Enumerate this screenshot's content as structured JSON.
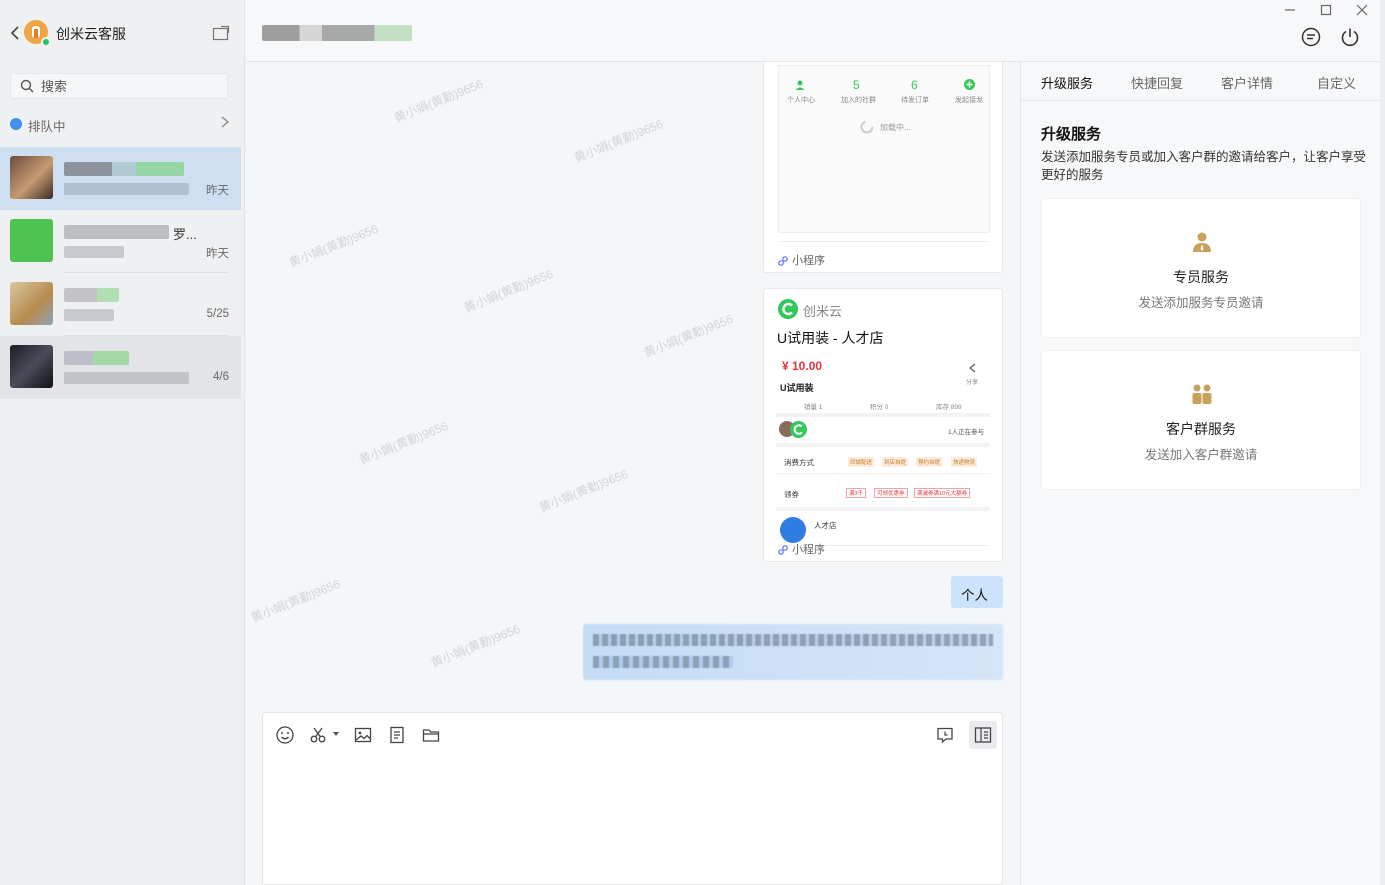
{
  "sidebar": {
    "app_name": "创米云客服",
    "search_placeholder": "搜索",
    "queue_label": "排队中",
    "conversations": [
      {
        "time": "昨天",
        "avatar_color": "#8a6a58"
      },
      {
        "name_suffix": "罗...",
        "time": "昨天",
        "avatar_color": "#4fc34f"
      },
      {
        "time": "5/25",
        "avatar_color": "#c9a86a"
      },
      {
        "time": "4/6",
        "avatar_color": "#2b2b36"
      }
    ]
  },
  "messages": {
    "mini1": {
      "stat_values": [
        "5",
        "6"
      ],
      "stat_labels": [
        "个人中心",
        "加入的社群",
        "待发订单",
        "发起接龙"
      ],
      "loading": "加载中...",
      "footer": "小程序"
    },
    "mini2": {
      "brand": "创米云",
      "title": "U试用装 - 人才店",
      "price": "¥ 10.00",
      "product": "U试用装",
      "share": "分享",
      "stats": [
        "销量 1",
        "积分 0",
        "库存 899"
      ],
      "participants": "1人正在参与",
      "row1_label": "消费方式",
      "row1_tags": [
        "同城配送",
        "到店自提",
        "预约自提",
        "快递物流"
      ],
      "row2_label": "领券",
      "row2_tags": [
        "满3千",
        "可领优惠券",
        "满减券满10元大额券"
      ],
      "shop": "人才店",
      "footer": "小程序"
    },
    "sent_text": "个人"
  },
  "watermark": "黄小娟(黄勤)9656",
  "panel": {
    "tabs": [
      "升级服务",
      "快捷回复",
      "客户详情",
      "自定义"
    ],
    "title": "升级服务",
    "desc": "发送添加服务专员或加入客户群的邀请给客户，让客户享受更好的服务",
    "services": [
      {
        "title": "专员服务",
        "desc": "发送添加服务专员邀请"
      },
      {
        "title": "客户群服务",
        "desc": "发送加入客户群邀请"
      }
    ]
  },
  "colors": {
    "accent_green": "#34c759",
    "price_red": "#e5353d",
    "gold": "#c8a15c"
  }
}
